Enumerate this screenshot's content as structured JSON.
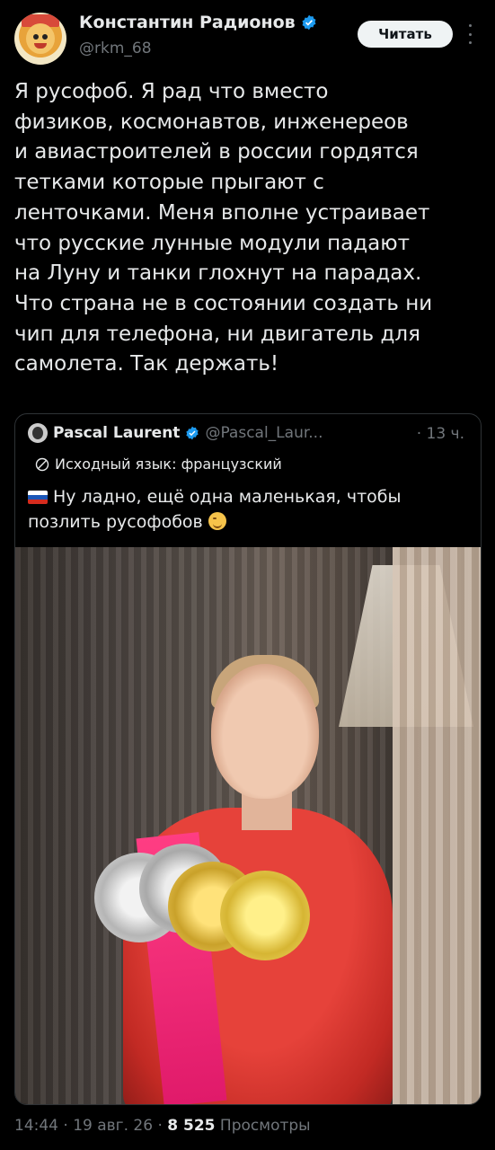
{
  "author": {
    "display_name": "Константин Радионов",
    "handle": "@rkm_68",
    "verified_icon": "verified-badge-icon"
  },
  "actions": {
    "follow_label": "Читать",
    "more_icon": "more-dots-icon"
  },
  "tweet": {
    "text": "Я русофоб. Я рад что вместо\nфизиков, космонавтов, инженереов\nи авиастроителей в россии гордятся\nтетками которые прыгают с\nленточками. Меня вполне устраивает\nчто русские лунные модули падают\nна Луну и танки глохнут на парадах.\nЧто страна не в состоянии создать ни\nчип для телефона, ни двигатель для\nсамолета. Так держать!"
  },
  "quote": {
    "author_name": "Pascal Laurent",
    "author_handle": "@Pascal_Laur...",
    "time": "· 13 ч.",
    "translate_label": "Исходный язык: французский",
    "text": "Ну ладно, ещё одна маленькая, чтобы позлить русофобов",
    "flag_icon": "russia-flag-icon",
    "emoji_icon": "wink-emoji-icon"
  },
  "meta": {
    "time": "14:44",
    "date": "· 19 авг. 26 ·",
    "views_count": "8 525",
    "views_label": "Просмотры"
  },
  "colors": {
    "background": "#000000",
    "text": "#e7e9ea",
    "secondary": "#71767b",
    "verified": "#1d9bf0",
    "border": "#2f3336"
  }
}
